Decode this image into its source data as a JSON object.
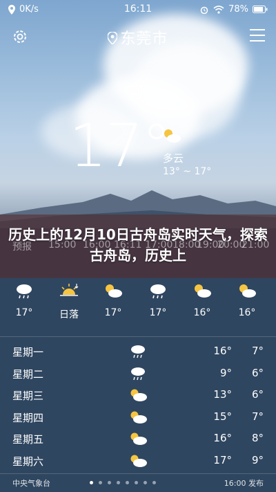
{
  "status_bar": {
    "network_speed": "0K/s",
    "time": "16:11",
    "battery": "78%"
  },
  "header": {
    "city": "东莞市"
  },
  "current": {
    "temperature": "17°",
    "condition": "多云",
    "range": "13° ~ 17°"
  },
  "banner": {
    "title": "历史上的12月10日古舟岛实时天气，探索古舟岛，历史上"
  },
  "ghost_row": {
    "left": "预报",
    "times": [
      "15:00",
      "16:00",
      "16:11",
      "17:00",
      "18:00",
      "19:00",
      "20:00",
      "21:00"
    ]
  },
  "hourly": [
    {
      "icon": "rain-cloud-icon",
      "label": "17°"
    },
    {
      "icon": "sunset-icon",
      "label": "日落"
    },
    {
      "icon": "partly-cloudy-icon",
      "label": "17°"
    },
    {
      "icon": "rain-cloud-icon",
      "label": "17°"
    },
    {
      "icon": "partly-cloudy-icon",
      "label": "16°"
    },
    {
      "icon": "partly-cloudy-icon",
      "label": "16°"
    }
  ],
  "daily": [
    {
      "day": "星期一",
      "icon": "rain-cloud-icon",
      "high": "16°",
      "low": "7°"
    },
    {
      "day": "星期二",
      "icon": "rain-cloud-icon",
      "high": "9°",
      "low": "6°"
    },
    {
      "day": "星期三",
      "icon": "partly-cloudy-icon",
      "high": "13°",
      "low": "6°"
    },
    {
      "day": "星期四",
      "icon": "partly-cloudy-icon",
      "high": "15°",
      "low": "7°"
    },
    {
      "day": "星期五",
      "icon": "partly-cloudy-icon",
      "high": "16°",
      "low": "8°"
    },
    {
      "day": "星期六",
      "icon": "partly-cloudy-icon",
      "high": "17°",
      "low": "9°"
    }
  ],
  "footer": {
    "source": "中央气象台",
    "updated": "16:00 发布",
    "page_count": 8,
    "active_page": 0
  },
  "colors": {
    "panel": "#2f4660",
    "sun": "#f5c542"
  }
}
